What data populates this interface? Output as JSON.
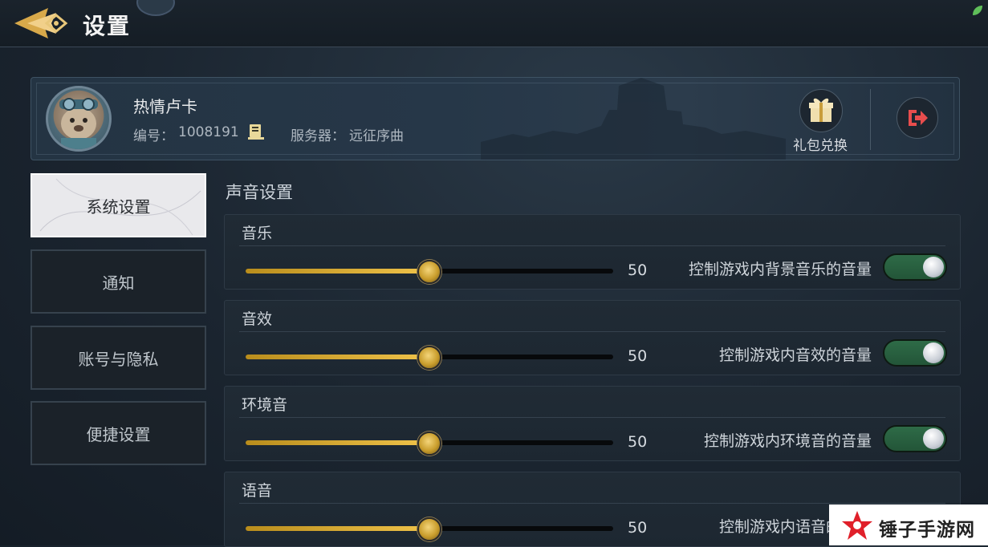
{
  "header": {
    "title": "设置",
    "back_icon": "back-arrow-icon"
  },
  "profile": {
    "username": "热情卢卡",
    "id_label": "编号：",
    "id_value": "1008191",
    "server_label": "服务器：",
    "server_value": "远征序曲",
    "gift_label": "礼包兑换",
    "gift_icon": "gift-icon",
    "logout_icon": "logout-icon"
  },
  "sidebar": {
    "items": [
      {
        "label": "系统设置",
        "active": true
      },
      {
        "label": "通知",
        "active": false
      },
      {
        "label": "账号与隐私",
        "active": false
      },
      {
        "label": "便捷设置",
        "active": false
      }
    ]
  },
  "sound": {
    "section_title": "声音设置",
    "rows": [
      {
        "label": "音乐",
        "value": "50",
        "level": 0.5,
        "description": "控制游戏内背景音乐的音量",
        "enabled": true
      },
      {
        "label": "音效",
        "value": "50",
        "level": 0.5,
        "description": "控制游戏内音效的音量",
        "enabled": true
      },
      {
        "label": "环境音",
        "value": "50",
        "level": 0.5,
        "description": "控制游戏内环境音的音量",
        "enabled": true
      },
      {
        "label": "语音",
        "value": "50",
        "level": 0.5,
        "description": "控制游戏内语音的音量",
        "enabled": true
      }
    ]
  },
  "watermark": {
    "text": "锤子手游网"
  },
  "colors": {
    "accent_gold": "#f0c34a",
    "toggle_on": "#2e6b47",
    "active_tab_bg": "#e9e9ec",
    "watermark_red": "#e0202a"
  }
}
